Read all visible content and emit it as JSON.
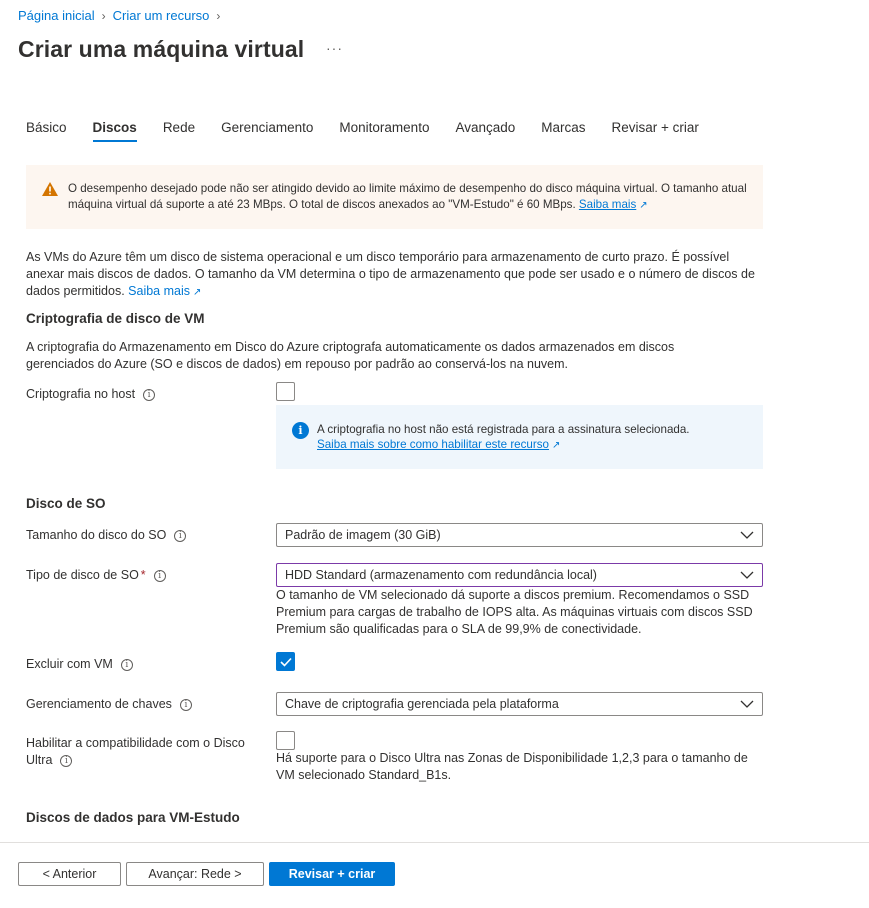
{
  "breadcrumb": {
    "home": "Página inicial",
    "create": "Criar um recurso"
  },
  "page": {
    "title": "Criar uma máquina virtual",
    "more": "···"
  },
  "tabs": [
    "Básico",
    "Discos",
    "Rede",
    "Gerenciamento",
    "Monitoramento",
    "Avançado",
    "Marcas",
    "Revisar + criar"
  ],
  "active_tab": "Discos",
  "warning": {
    "text": "O desempenho desejado pode não ser atingido devido ao limite máximo de desempenho do disco máquina virtual. O tamanho atual máquina virtual dá suporte a até 23 MBps. O total de discos anexados ao \"VM-Estudo\" é 60 MBps.",
    "link": "Saiba mais"
  },
  "intro": {
    "text": "As VMs do Azure têm um disco de sistema operacional e um disco temporário para armazenamento de curto prazo. É possível anexar mais discos de dados. O tamanho da VM determina o tipo de armazenamento que pode ser usado e o número de discos de dados permitidos.",
    "link": "Saiba mais"
  },
  "encryption": {
    "heading": "Criptografia de disco de VM",
    "text": "A criptografia do Armazenamento em Disco do Azure criptografa automaticamente os dados armazenados em discos gerenciados do Azure (SO e discos de dados) em repouso por padrão ao conservá-los na nuvem.",
    "host_label": "Criptografia no host",
    "host_checked": false,
    "info_text": "A criptografia no host não está registrada para a assinatura selecionada.",
    "info_link": "Saiba mais sobre como habilitar este recurso"
  },
  "os_disk": {
    "heading": "Disco de SO",
    "size_label": "Tamanho do disco do SO",
    "size_value": "Padrão de imagem (30 GiB)",
    "type_label": "Tipo de disco de SO",
    "required_mark": "*",
    "type_value": "HDD Standard (armazenamento com redundância local)",
    "type_help": "O tamanho de VM selecionado dá suporte a discos premium. Recomendamos o SSD Premium para cargas de trabalho de IOPS alta. As máquinas virtuais com discos SSD Premium são qualificadas para o SLA de 99,9% de conectividade.",
    "delete_label": "Excluir com VM",
    "delete_checked": true,
    "key_label": "Gerenciamento de chaves",
    "key_value": "Chave de criptografia gerenciada pela plataforma",
    "ultra_label_1": "Habilitar a compatibilidade com o Disco",
    "ultra_label_2": "Ultra",
    "ultra_checked": false,
    "ultra_help": "Há suporte para o Disco Ultra nas Zonas de Disponibilidade 1,2,3 para o tamanho de VM selecionado Standard_B1s."
  },
  "data_disks": {
    "heading": "Discos de dados para VM-Estudo"
  },
  "footer": {
    "prev": "< Anterior",
    "next": "Avançar: Rede >",
    "review": "Revisar + criar"
  },
  "colors": {
    "accent": "#0078d4",
    "warning_bg": "#fdf6f0",
    "warning_icon": "#d47500",
    "info_bg": "#eff6fc",
    "required": "#a4262c"
  }
}
